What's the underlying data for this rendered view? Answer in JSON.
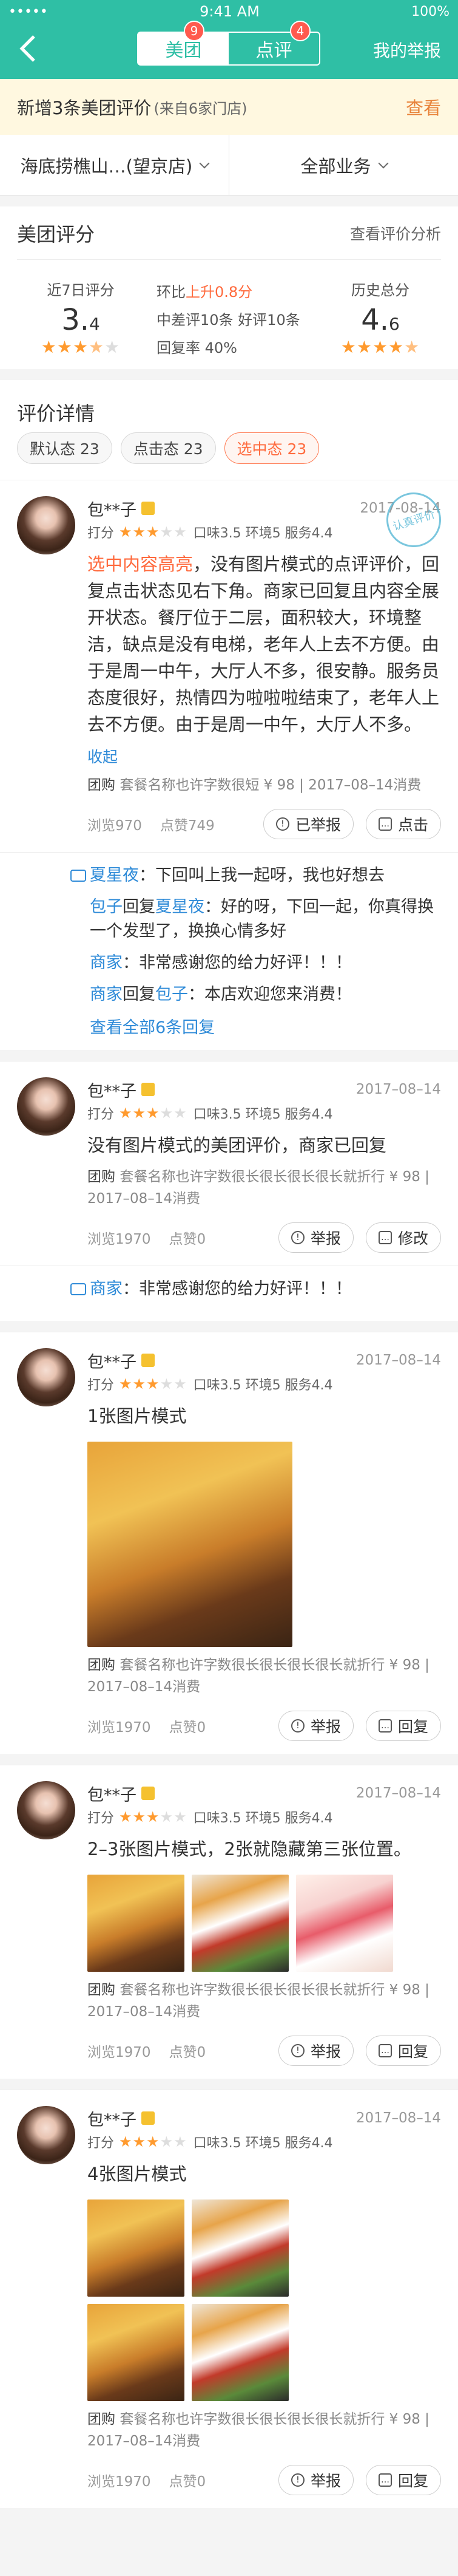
{
  "status": {
    "signal": "•••••",
    "wifi": "wifi",
    "time": "9:41 AM",
    "battery": "100%"
  },
  "header": {
    "tab_meituan": "美团",
    "tab_meituan_badge": "9",
    "tab_dianping": "点评",
    "tab_dianping_badge": "4",
    "report": "我的举报",
    "accent": "#2fbfa5"
  },
  "notice": {
    "text": "新增3条美团评价",
    "source": "(来自6家门店)",
    "action": "查看"
  },
  "filters": {
    "store": "海底捞樵山…(望京店)",
    "business": "全部业务"
  },
  "rating": {
    "title": "美团评分",
    "link": "查看评价分析",
    "recent_label": "近7日评分",
    "recent_int": "3.",
    "recent_dec": "4",
    "ring_label": "环比",
    "ring_value": "上升0.8分",
    "mid_bad": "中差评10条",
    "good": "好评10条",
    "reply_rate": "回复率 40%",
    "history_label": "历史总分",
    "history_int": "4.",
    "history_dec": "6"
  },
  "details": {
    "title": "评价详情",
    "tags": [
      "默认态 23",
      "点击态 23",
      "选中态 23"
    ]
  },
  "reviews": [
    {
      "user": "包**子",
      "date": "2017-08-14",
      "score_label": "打分",
      "sub": "口味3.5 环境5 服务4.4",
      "highlight": "选中内容高亮",
      "text": "，没有图片模式的点评评价，回复点击状态见右下角。商家已回复且内容全展开状态。餐厅位于二层，面积较大，环境整洁，缺点是没有电梯，老年人上去不方便。由于是周一中午，大厅人不多，很安静。服务员态度很好，热情四为啦啦啦结束了，老年人上去不方便。由于是周一中午，大厅人不多。",
      "fold": "收起",
      "group_prefix": "团购",
      "group": "套餐名称也许字数很短 ¥ 98 | 2017–08–14消费",
      "views": "浏览970",
      "likes": "点赞749",
      "btn1": "已举报",
      "btn2": "点击",
      "stamp": "认真评价",
      "replies": [
        {
          "name": "夏星夜",
          "sep": "：",
          "text": "下回叫上我一起呀，我也好想去"
        },
        {
          "name": "包子",
          "mid": "回复",
          "name2": "夏星夜",
          "sep": "：",
          "text": "好的呀，下回一起，你真得换一个发型了，换换心情多好"
        },
        {
          "name": "商家",
          "sep": "：",
          "text": "非常感谢您的给力好评！！！"
        },
        {
          "name": "商家",
          "mid": "回复",
          "name2": "包子",
          "sep": "：",
          "text": "本店欢迎您来消费！"
        }
      ],
      "more": "查看全部6条回复"
    },
    {
      "user": "包**子",
      "date": "2017–08–14",
      "score_label": "打分",
      "sub": "口味3.5 环境5 服务4.4",
      "text": "没有图片模式的美团评价，商家已回复",
      "group_prefix": "团购",
      "group": "套餐名称也许字数很长很长很长很长就折行 ¥ 98 | 2017–08–14消费",
      "views": "浏览1970",
      "likes": "点赞0",
      "btn1": "举报",
      "btn2": "修改",
      "replies": [
        {
          "name": "商家",
          "sep": "：",
          "text": "非常感谢您的给力好评！！！"
        }
      ]
    },
    {
      "user": "包**子",
      "date": "2017–08–14",
      "score_label": "打分",
      "sub": "口味3.5 环境5 服务4.4",
      "text": "1张图片模式",
      "group_prefix": "团购",
      "group": "套餐名称也许字数很长很长很长很长就折行 ¥ 98 | 2017–08–14消费",
      "views": "浏览1970",
      "likes": "点赞0",
      "btn1": "举报",
      "btn2": "回复"
    },
    {
      "user": "包**子",
      "date": "2017–08–14",
      "score_label": "打分",
      "sub": "口味3.5 环境5 服务4.4",
      "text": "2–3张图片模式，2张就隐藏第三张位置。",
      "group_prefix": "团购",
      "group": "套餐名称也许字数很长很长很长很长就折行 ¥ 98 | 2017–08–14消费",
      "views": "浏览1970",
      "likes": "点赞0",
      "btn1": "举报",
      "btn2": "回复"
    },
    {
      "user": "包**子",
      "date": "2017–08–14",
      "score_label": "打分",
      "sub": "口味3.5 环境5 服务4.4",
      "text": "4张图片模式",
      "group_prefix": "团购",
      "group": "套餐名称也许字数很长很长很长很长就折行 ¥ 98 | 2017–08–14消费",
      "views": "浏览1970",
      "likes": "点赞0",
      "btn1": "举报",
      "btn2": "回复"
    }
  ]
}
